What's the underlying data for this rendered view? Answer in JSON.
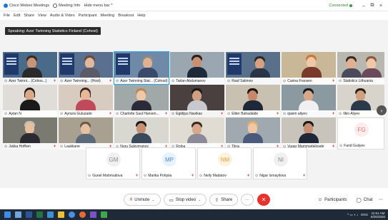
{
  "titlebar": {
    "app": "Cisco Webex Meetings",
    "meeting_info": "Meeting Info",
    "hide_menu": "Hide menu bar ^",
    "connected": "Connected",
    "minimize": "–",
    "restore": "⧉",
    "close": "×"
  },
  "menu": [
    "File",
    "Edit",
    "Share",
    "View",
    "Audio & Video",
    "Participant",
    "Meeting",
    "Breakout",
    "Help"
  ],
  "speaker": "Speaking: Azer Twinning Statistics Finland (Cohost)",
  "tiles_row1": [
    {
      "name": "Azer Twinni... (Cohos...)"
    },
    {
      "name": "Azer Twinning... (Host)"
    },
    {
      "name": "Azer Twinning Stat... (Cohost)"
    },
    {
      "name": "Tarlan Abdumanov"
    },
    {
      "name": "Rauf Salimov"
    },
    {
      "name": "Carina Fransen"
    },
    {
      "name": "Statistics Lithuania"
    }
  ],
  "tiles_row2": [
    {
      "name": "Aytan N"
    },
    {
      "name": "Aynura Guluzade"
    },
    {
      "name": "Charlotte Saul Hansen..."
    },
    {
      "name": "Egidijus Navikas"
    },
    {
      "name": "Elder Bahadalde"
    },
    {
      "name": "qasim aliyev"
    },
    {
      "name": "Ilkin Aliyev"
    }
  ],
  "tiles_row3": [
    {
      "name": "Jukka Hoffren"
    },
    {
      "name": "Laukkane"
    },
    {
      "name": "Nuru Suleymanov"
    },
    {
      "name": "Rolna"
    },
    {
      "name": "Tiina"
    },
    {
      "name": "Vugar Mammadalizade"
    },
    {
      "name": "Farid Guliyev",
      "initials": "FG"
    }
  ],
  "tiles_row4": [
    {
      "name": "Gunel Mahmudova",
      "initials": "GM"
    },
    {
      "name": "Marika Pohjola",
      "initials": "MP"
    },
    {
      "name": "Nelly Madatov",
      "initials": "NM"
    },
    {
      "name": "Nigar Ismayilova",
      "initials": "NI"
    }
  ],
  "controls": {
    "unmute": "Unmute",
    "stop_video": "Stop video",
    "share": "Share",
    "more": "···",
    "participants": "Participants",
    "chat": "Chat"
  },
  "taskbar": {
    "lang": "ENG",
    "time": "11:51 AM",
    "date": "6/25/2020"
  },
  "colors": {
    "accent": "#1a73e8",
    "end_call": "#e8322b",
    "active_border": "#22a7f0",
    "taskbar": "#1f2a38"
  }
}
